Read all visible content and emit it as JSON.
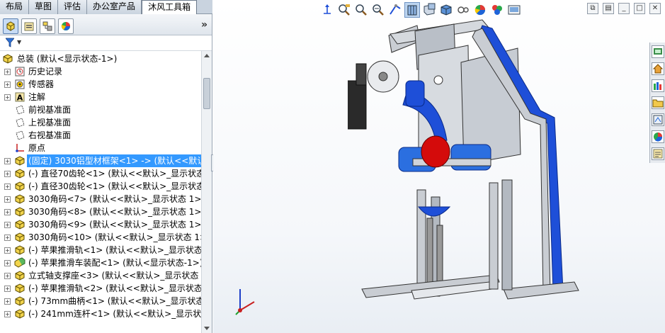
{
  "command_tabs": [
    "布局",
    "草图",
    "评估",
    "办公室产品",
    "沐风工具箱"
  ],
  "active_tab_index": 4,
  "panel": {
    "collapse_glyph": "»",
    "tab_icons": [
      "feature-manager-icon",
      "property-manager-icon",
      "configuration-manager-icon",
      "display-manager-icon"
    ],
    "filter_icon": "filter-icon"
  },
  "tree": {
    "root": "总装  (默认<显示状态-1>)",
    "items": [
      {
        "label": "历史记录",
        "icon": "history-icon",
        "expand": true
      },
      {
        "label": "传感器",
        "icon": "sensor-icon",
        "expand": true
      },
      {
        "label": "注解",
        "icon": "annotation-icon",
        "expand": true
      },
      {
        "label": "前视基准面",
        "icon": "plane-icon",
        "expand": false
      },
      {
        "label": "上视基准面",
        "icon": "plane-icon",
        "expand": false
      },
      {
        "label": "右视基准面",
        "icon": "plane-icon",
        "expand": false
      },
      {
        "label": "原点",
        "icon": "origin-icon",
        "expand": false
      },
      {
        "label": "(固定) 3030铝型材框架<1> -> (默认<<默认",
        "icon": "part-icon",
        "expand": true,
        "selected": true
      },
      {
        "label": "(-) 直径70齿轮<1> (默认<<默认>_显示状态",
        "icon": "part-icon",
        "expand": true
      },
      {
        "label": "(-) 直径30齿轮<1> (默认<<默认>_显示状态",
        "icon": "part-icon",
        "expand": true
      },
      {
        "label": "3030角码<7> (默认<<默认>_显示状态 1>)",
        "icon": "part-icon",
        "expand": true
      },
      {
        "label": "3030角码<8> (默认<<默认>_显示状态 1>)",
        "icon": "part-icon",
        "expand": true
      },
      {
        "label": "3030角码<9> (默认<<默认>_显示状态 1>)",
        "icon": "part-icon",
        "expand": true
      },
      {
        "label": "3030角码<10> (默认<<默认>_显示状态 1>",
        "icon": "part-icon",
        "expand": true
      },
      {
        "label": "(-) 苹果推滑轨<1> (默认<<默认>_显示状态",
        "icon": "part-icon",
        "expand": true
      },
      {
        "label": "(-) 苹果推滑车装配<1> (默认<显示状态-1>)",
        "icon": "assembly-icon",
        "expand": true
      },
      {
        "label": "立式轴支撑座<3> (默认<<默认>_显示状态 1",
        "icon": "part-icon",
        "expand": true
      },
      {
        "label": "(-) 苹果推滑轨<2> (默认<<默认>_显示状态",
        "icon": "part-icon",
        "expand": true
      },
      {
        "label": "(-) 73mm曲柄<1> (默认<<默认>_显示状态",
        "icon": "part-icon",
        "expand": true
      },
      {
        "label": "(-) 241mm连杆<1> (默认<<默认>_显示状态",
        "icon": "part-icon",
        "expand": true
      }
    ]
  },
  "heads_up_toolbar": [
    "reference-triad-icon",
    "zoom-to-fit-icon",
    "zoom-to-area-icon",
    "previous-view-icon",
    "section-view-icon",
    "view-orientation-icon",
    "display-style-icon",
    "hide-show-icon",
    "edit-appearance-icon",
    "apply-scene-icon",
    "view-settings-icon"
  ],
  "window_controls": [
    "restore-icon",
    "tile-icon",
    "minimize-icon",
    "maximize-icon",
    "close-icon"
  ],
  "task_pane_icons": [
    "resources-icon",
    "home-icon",
    "design-library-icon",
    "file-explorer-icon",
    "view-palette-icon",
    "appearances-icon",
    "custom-properties-icon"
  ],
  "colors": {
    "accent_blue": "#1e4fd8",
    "apple_red": "#d40b0b",
    "frame_gray": "#c9cdd3",
    "selection": "#3399ff"
  }
}
